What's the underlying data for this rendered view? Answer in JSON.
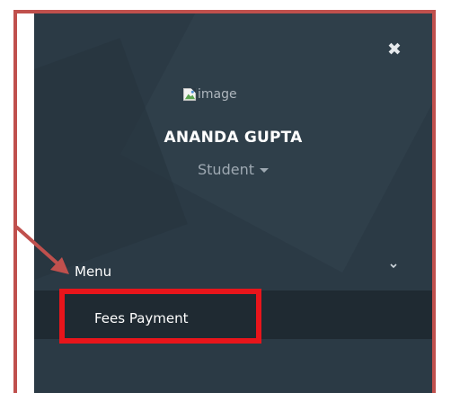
{
  "sidebar": {
    "close_icon": "close-icon",
    "avatar": {
      "alt_text": "image",
      "icon": "broken-image-icon"
    },
    "user": {
      "name": "ANANDA GUPTA",
      "role": "Student",
      "role_dropdown_icon": "caret-down-icon"
    },
    "menu": {
      "label": "Menu",
      "expand_icon": "chevron-down-icon",
      "items": [
        {
          "label": "Fees Payment"
        }
      ]
    }
  },
  "annotations": {
    "frame_color": "#c0504d",
    "highlight_color": "#e8151b",
    "arrow_color": "#c0504d"
  },
  "colors": {
    "sidebar_bg": "#2b3a45",
    "submenu_bg": "#1f2a32",
    "text_primary": "#ffffff",
    "text_muted": "#9ea9b2"
  }
}
